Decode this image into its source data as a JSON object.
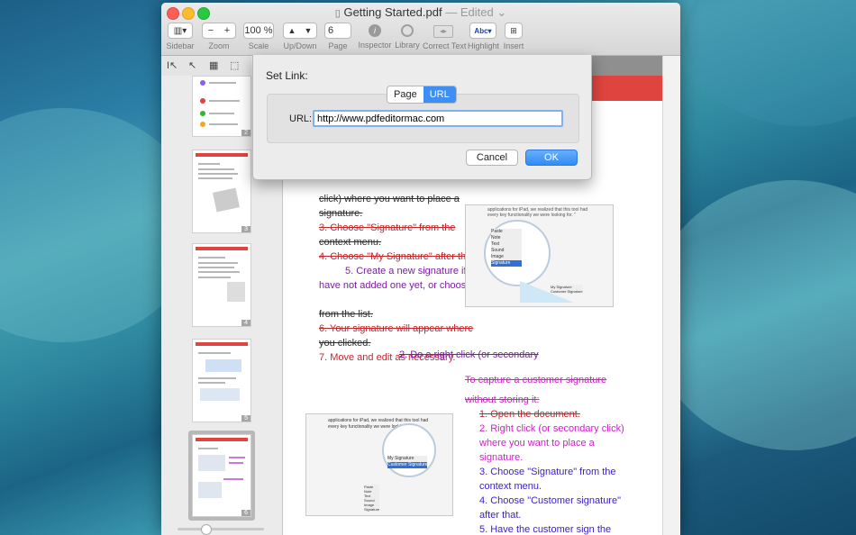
{
  "window": {
    "filename": "Getting Started.pdf",
    "separator": "—",
    "status": "Edited",
    "status_chevron": "⌄"
  },
  "toolbar": {
    "sidebar_label": "Sidebar",
    "zoom_label": "Zoom",
    "zoom_minus": "−",
    "zoom_plus": "+",
    "scale_label": "Scale",
    "scale_value": "100 %",
    "updown_label": "Up/Down",
    "up_glyph": "▲",
    "down_glyph": "▼",
    "page_label": "Page",
    "page_value": "6",
    "inspector_label": "Inspector",
    "library_label": "Library",
    "correct_text_label": "Correct Text",
    "highlight_label": "Highlight",
    "highlight_icon_text": "Abc",
    "insert_label": "Insert"
  },
  "thumbnails": [
    {
      "num": "2"
    },
    {
      "num": "3"
    },
    {
      "num": "4"
    },
    {
      "num": "5"
    },
    {
      "num": "6"
    }
  ],
  "dialog": {
    "title": "Set Link:",
    "tab_page": "Page",
    "tab_url": "URL",
    "url_label": "URL:",
    "url_value": "http://www.pdfeditormac.com",
    "cancel_label": "Cancel",
    "ok_label": "OK"
  },
  "doc": {
    "l1": "click) where you want to place a",
    "l2": "signature.",
    "l3": "3. Choose \"Signature\" from the",
    "l4": "context menu.",
    "l5": "4. Choose \"My Signature\" after that.",
    "l6": "5. Create a new signature if you",
    "l7": "have not added one yet, or choose",
    "l8": "from the list.",
    "l9": "6. Your signature will appear where",
    "l10": "you clicked.",
    "l11": "7. Move and edit as necessary.",
    "l12": "2. Do a right click (or secondary",
    "r1": "To capture a customer signature",
    "r2": "without storing it:",
    "r3": "1. Open the document.",
    "r4": "2. Right click (or secondary click)",
    "r5": "where you want to place a",
    "r6": "signature.",
    "r7": "3. Choose \"Signature\" from the",
    "r8": "context menu.",
    "r9": "4. Choose \"Customer signature\"",
    "r10": "after that.",
    "r11": "5. Have the customer sign the"
  },
  "shot1": {
    "head": "applications for iPad, we realized that this tool had",
    "head2": "every key functionality we were looking for. \"",
    "menu": [
      "Paste",
      "Note",
      "Text",
      "Sound",
      "Image",
      "Signature"
    ],
    "sub": [
      "My Signature",
      "Customer Signature"
    ]
  },
  "shot2": {
    "head": "applications for iPad, we realized that this tool had",
    "head2": "every key functionality we were looking for. \"",
    "sub": [
      "My Signature",
      "Customer Signature"
    ],
    "menu": [
      "Paste",
      "Note",
      "Text",
      "Sound",
      "Image",
      "Signature"
    ]
  },
  "colors": {
    "accent_red": "#e0443e",
    "ok_blue": "#2f8cf6",
    "seg_selected": "#3d8ef5"
  }
}
